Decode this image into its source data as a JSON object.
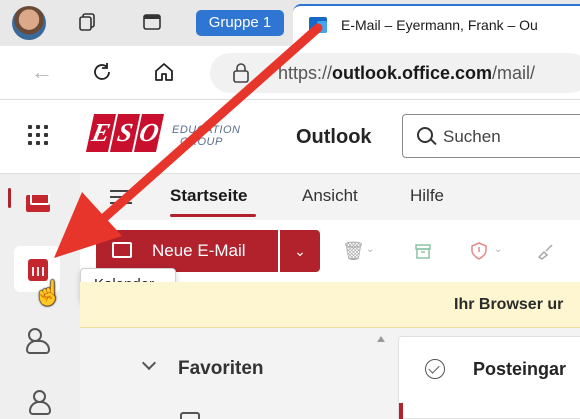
{
  "browser": {
    "tab_group_label": "Gruppe 1",
    "active_tab_title": "E-Mail – Eyermann, Frank – Ou",
    "url_prefix": "https://",
    "url_domain": "outlook.office.com",
    "url_path": "/mail/"
  },
  "header": {
    "logo_letters": [
      "E",
      "S",
      "O"
    ],
    "logo_subtitle_line1": "EDUCATION",
    "logo_subtitle_line2": "GROUP",
    "app_name": "Outlook",
    "search_placeholder": "Suchen"
  },
  "ribbon": {
    "tabs": [
      "Startseite",
      "Ansicht",
      "Hilfe"
    ],
    "active_tab": "Startseite",
    "new_mail_label": "Neue E-Mail"
  },
  "rail": {
    "tooltip": "Kalender",
    "items": [
      "mail-icon",
      "calendar-icon",
      "people-icon",
      "groups-icon"
    ]
  },
  "infobar": {
    "text": "Ihr Browser ur"
  },
  "folders": {
    "favorites_label": "Favoriten"
  },
  "message_list": {
    "folder_title": "Posteingar"
  },
  "colors": {
    "accent": "#b1222d",
    "tab_group": "#2f76d2",
    "arrow": "#e8352c",
    "infobar": "#fdf6d0"
  }
}
